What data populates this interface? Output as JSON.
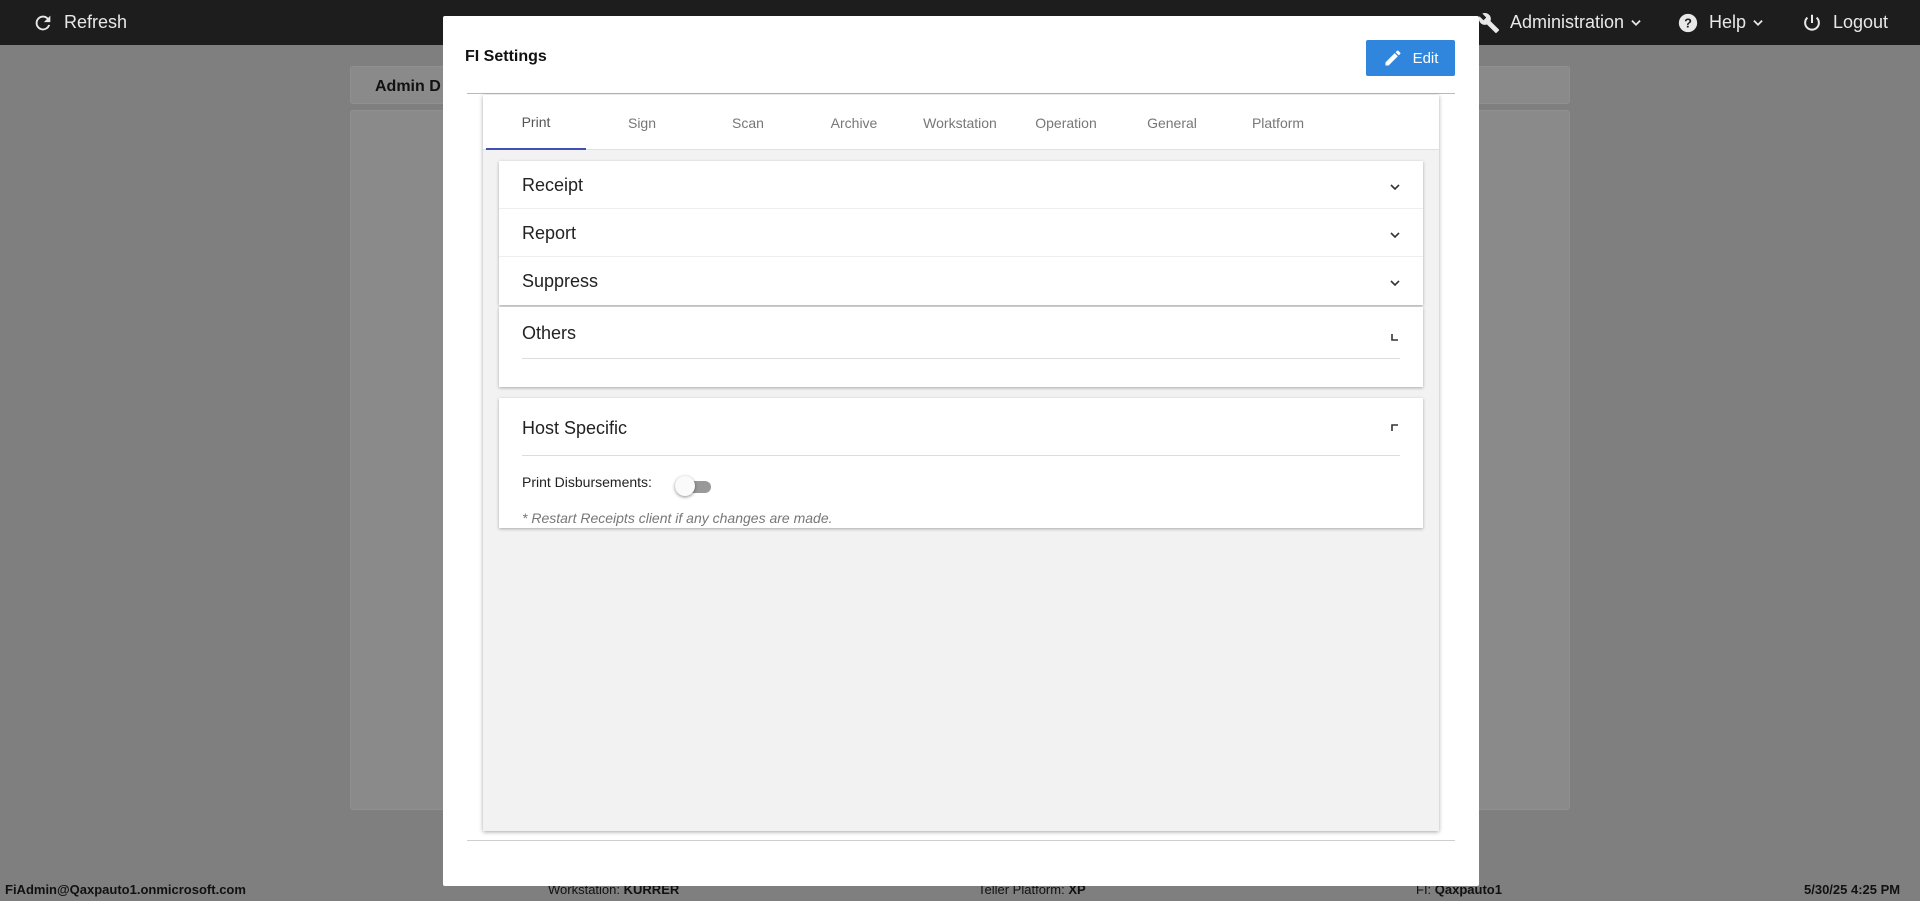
{
  "topbar": {
    "refresh_label": "Refresh",
    "admin_label": "Administration",
    "help_label": "Help",
    "logout_label": "Logout"
  },
  "background": {
    "title": "Admin D"
  },
  "statusbar": {
    "user": "FiAdmin@Qaxpauto1.onmicrosoft.com",
    "workstation_label": "Workstation:",
    "workstation_value": "KURRER",
    "platform_label": "Teller Platform:",
    "platform_value": "XP",
    "fi_label": "FI:",
    "fi_value": "Qaxpauto1",
    "datetime": "5/30/25 4:25 PM"
  },
  "modal": {
    "title": "FI Settings",
    "edit_label": "Edit",
    "tabs": [
      "Print",
      "Sign",
      "Scan",
      "Archive",
      "Workstation",
      "Operation",
      "General",
      "Platform"
    ],
    "active_tab": "Print",
    "sections": {
      "receipt": "Receipt",
      "report": "Report",
      "suppress": "Suppress",
      "others": "Others",
      "host_specific": "Host Specific"
    },
    "host": {
      "print_disbursements_label": "Print Disbursements:",
      "print_disbursements_value": false,
      "note": "* Restart Receipts client if any changes are made."
    }
  },
  "colors": {
    "accent": "#2f86dc",
    "tab_indicator": "#3f51b5",
    "topbar": "#1d1d1d"
  }
}
